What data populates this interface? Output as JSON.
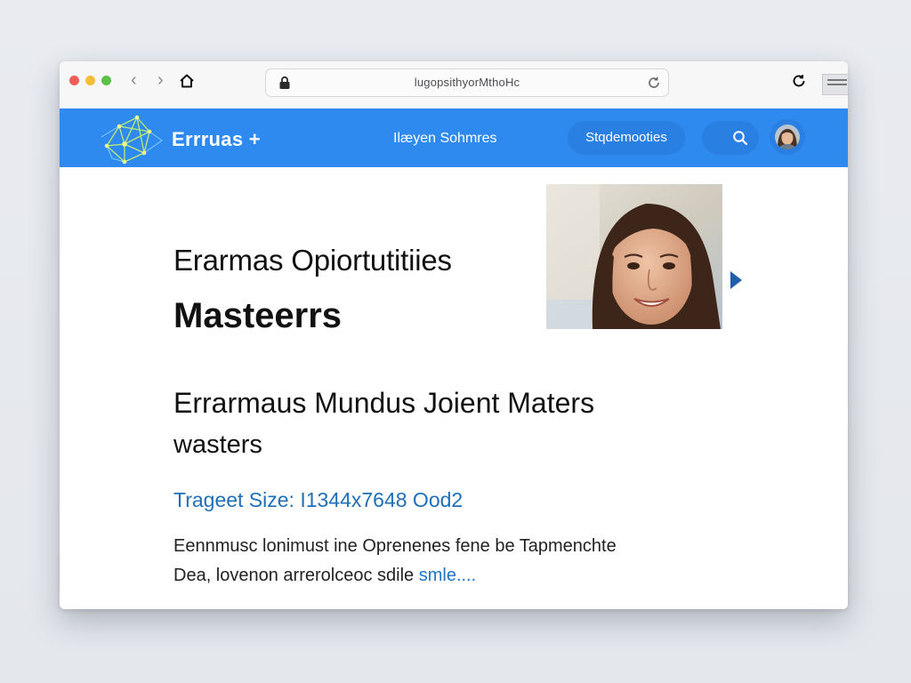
{
  "browser": {
    "url": "lugopsithyorMthoHc",
    "nav_back": "‹",
    "nav_forward": "›"
  },
  "header": {
    "brand": "Errruas +",
    "nav_link": "Ilæyen Sohmres",
    "nav_pill": "Stqdemooties",
    "accent_color": "#2f8af0"
  },
  "main": {
    "title_line1": "Erarmas Opiortutitiies",
    "title_line2": "Masteerrs",
    "subtitle_line1": "Errarmaus Mundus Joient Maters",
    "subtitle_line2": "wasters",
    "meta": "Trageet Size: I1344x7648 Ood2",
    "paragraph_line1": "Eennmusc lonimust ine Oprenenes fene be Tapmenchte",
    "paragraph_line2_prefix": "Dea, lovenon arrerolceoc sdile",
    "read_more": "smle...."
  },
  "icons": {
    "lock": "lock-icon",
    "home": "home-icon",
    "reload": "reload-icon",
    "search": "search-icon",
    "logo": "network-logo-icon",
    "carousel_next": "play-arrow-icon"
  }
}
